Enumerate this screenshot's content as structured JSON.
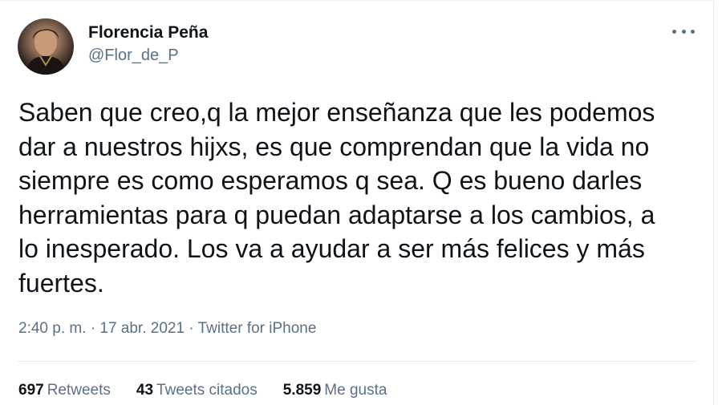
{
  "user": {
    "display_name": "Florencia Peña",
    "handle": "@Flor_de_P",
    "avatar_icon": "avatar-photo"
  },
  "tweet": {
    "lines": [
      "Saben que creo,q la mejor enseñanza que les podemos",
      "dar a nuestros hijxs, es que comprendan que la vida no",
      "siempre es como esperamos q sea. Q es bueno darles",
      "herramientas para q puedan adaptarse a los cambios, a",
      "lo inesperado. Los va a ayudar a ser más felices y más",
      "fuertes."
    ],
    "time": "2:40 p. m.",
    "separator": "·",
    "date": "17 abr. 2021",
    "source": "Twitter for iPhone"
  },
  "stats": {
    "retweets_count": "697",
    "retweets_label": "Retweets",
    "quotes_count": "43",
    "quotes_label": "Tweets citados",
    "likes_count": "5.859",
    "likes_label": "Me gusta"
  },
  "colors": {
    "text_primary": "#0f1419",
    "text_secondary": "#5b7083",
    "divider": "#e6ecf0"
  }
}
